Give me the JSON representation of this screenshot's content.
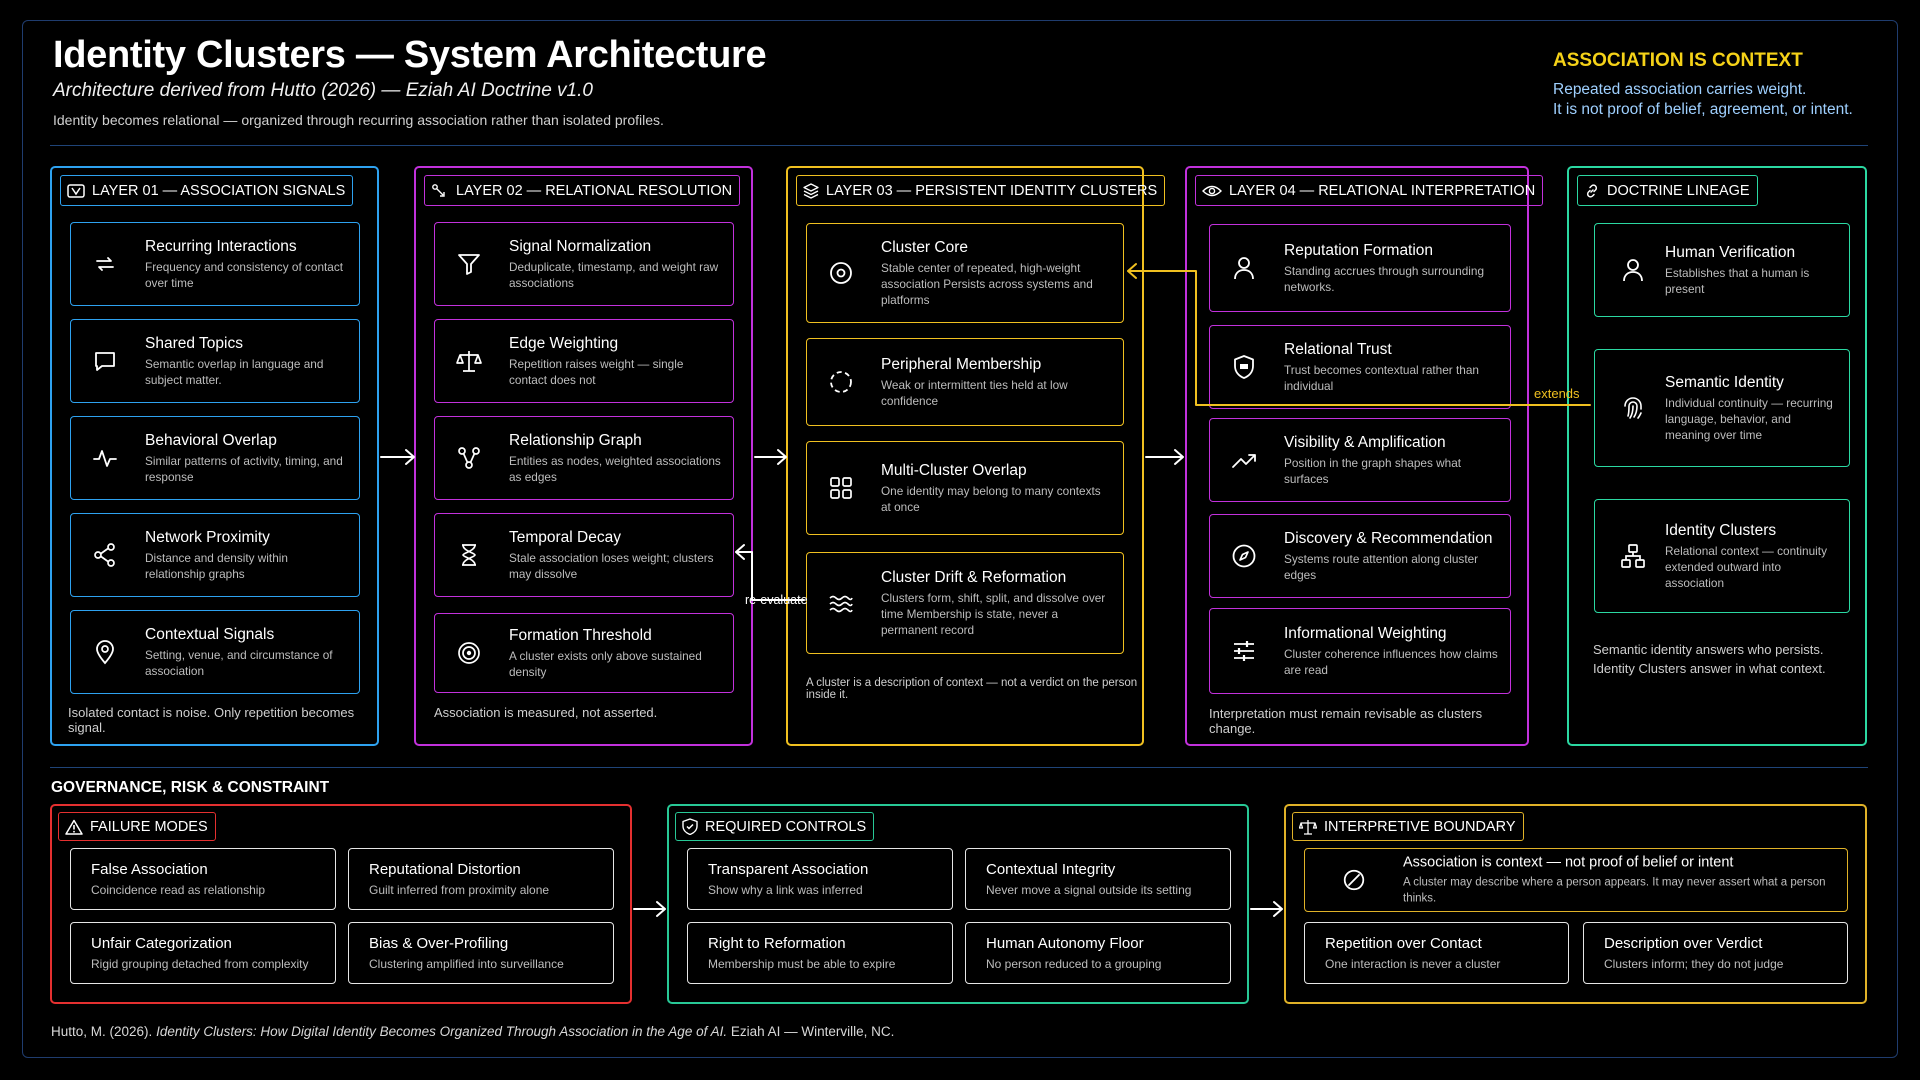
{
  "header": {
    "title": "Identity Clusters — System Architecture",
    "subtitle": "Architecture derived from Hutto (2026) — Eziah AI Doctrine v1.0",
    "tagline": "Identity becomes relational — organized through recurring association rather than isolated profiles.",
    "context_heading": "ASSOCIATION IS CONTEXT",
    "context_line1": "Repeated association carries weight.",
    "context_line2": "It is not proof of belief, agreement, or intent."
  },
  "layers": [
    {
      "title": "LAYER 01 — ASSOCIATION SIGNALS",
      "color": "#2ea2f0",
      "footer": "Isolated contact is noise. Only repetition becomes signal.",
      "cards": [
        {
          "name": "Recurring Interactions",
          "desc": "Frequency and consistency of contact over time",
          "icon": "repeat-icon"
        },
        {
          "name": "Shared Topics",
          "desc": "Semantic overlap in language and subject matter.",
          "icon": "chat-bubble-icon"
        },
        {
          "name": "Behavioral Overlap",
          "desc": "Similar patterns of activity, timing, and response",
          "icon": "pulse-icon"
        },
        {
          "name": "Network Proximity",
          "desc": "Distance and density within relationship graphs",
          "icon": "share-nodes-icon"
        },
        {
          "name": "Contextual Signals",
          "desc": "Setting, venue, and circumstance of association",
          "icon": "location-pin-icon"
        }
      ]
    },
    {
      "title": "LAYER 02 — RELATIONAL RESOLUTION",
      "color": "#c231dc",
      "footer": "Association is measured, not asserted.",
      "cards": [
        {
          "name": "Signal Normalization",
          "desc": "Deduplicate, timestamp, and weight raw associations",
          "icon": "filter-icon"
        },
        {
          "name": "Edge Weighting",
          "desc": "Repetition raises weight — single contact does not",
          "icon": "scale-icon"
        },
        {
          "name": "Relationship Graph",
          "desc": "Entities as nodes, weighted associations as edges",
          "icon": "graph-icon"
        },
        {
          "name": "Temporal Decay",
          "desc": "Stale association loses weight; clusters may dissolve",
          "icon": "hourglass-icon"
        },
        {
          "name": "Formation Threshold",
          "desc": "A cluster exists only above sustained density",
          "icon": "target-icon"
        }
      ]
    },
    {
      "title": "LAYER 03 — PERSISTENT IDENTITY CLUSTERS",
      "color": "#f0c020",
      "footer": "A cluster is a description of context — not a verdict on the person inside it.",
      "cards": [
        {
          "name": "Cluster Core",
          "desc": "Stable center of repeated, high-weight association Persists across systems and platforms",
          "icon": "core-icon"
        },
        {
          "name": "Peripheral Membership",
          "desc": "Weak or intermittent ties held at low confidence",
          "icon": "dashed-circle-icon"
        },
        {
          "name": "Multi-Cluster Overlap",
          "desc": "One identity may belong to many contexts at once",
          "icon": "grid-icon"
        },
        {
          "name": "Cluster Drift & Reformation",
          "desc": "Clusters form, shift, split, and dissolve over time Membership is state, never a permanent record",
          "icon": "waves-icon"
        }
      ]
    },
    {
      "title": "LAYER 04 — RELATIONAL INTERPRETATION",
      "color": "#c231dc",
      "footer": "Interpretation must remain revisable as clusters change.",
      "cards": [
        {
          "name": "Reputation Formation",
          "desc": "Standing accrues through surrounding networks.",
          "icon": "user-icon"
        },
        {
          "name": "Relational Trust",
          "desc": "Trust becomes contextual rather than individual",
          "icon": "shield-icon"
        },
        {
          "name": "Visibility & Amplification",
          "desc": "Position in the graph shapes what surfaces",
          "icon": "trending-up-icon"
        },
        {
          "name": "Discovery & Recommendation",
          "desc": "Systems route attention along cluster edges",
          "icon": "compass-icon"
        },
        {
          "name": "Informational Weighting",
          "desc": "Cluster coherence influences how claims are read",
          "icon": "sliders-icon"
        }
      ]
    },
    {
      "title": "DOCTRINE LINEAGE",
      "color": "#2bd8a2",
      "footer_line1": "Semantic identity answers who persists.",
      "footer_line2": "Identity Clusters answer in what context.",
      "cards": [
        {
          "name": "Human Verification",
          "desc": "Establishes that a human is present",
          "icon": "user-icon"
        },
        {
          "name": "Semantic Identity",
          "desc": "Individual continuity — recurring language, behavior, and meaning over time",
          "icon": "fingerprint-icon"
        },
        {
          "name": "Identity Clusters",
          "desc": "Relational context — continuity extended outward into association",
          "icon": "hierarchy-icon"
        }
      ]
    }
  ],
  "connectors": {
    "extends_label": "extends",
    "reevaluate_label": "re-evaluate"
  },
  "governance": {
    "heading": "GOVERNANCE, RISK & CONSTRAINT",
    "failure_modes": {
      "title": "FAILURE MODES",
      "color": "#e53030",
      "items": [
        {
          "name": "False Association",
          "desc": "Coincidence read as relationship"
        },
        {
          "name": "Reputational Distortion",
          "desc": "Guilt inferred from proximity alone"
        },
        {
          "name": "Unfair Categorization",
          "desc": "Rigid grouping detached from complexity"
        },
        {
          "name": "Bias & Over-Profiling",
          "desc": "Clustering amplified into surveillance"
        }
      ]
    },
    "required_controls": {
      "title": "REQUIRED CONTROLS",
      "color": "#28c896",
      "items": [
        {
          "name": "Transparent Association",
          "desc": "Show why a link was inferred"
        },
        {
          "name": "Contextual Integrity",
          "desc": "Never move a signal outside its setting"
        },
        {
          "name": "Right to Reformation",
          "desc": "Membership must be able to expire"
        },
        {
          "name": "Human Autonomy Floor",
          "desc": "No person reduced to a grouping"
        }
      ]
    },
    "interpretive_boundary": {
      "title": "INTERPRETIVE BOUNDARY",
      "color": "#e0b228",
      "main": {
        "name": "Association is context — not proof of belief or intent",
        "desc": "A cluster may describe where a person appears. It may never assert what a person thinks."
      },
      "items": [
        {
          "name": "Repetition over Contact",
          "desc": "One interaction is never a cluster"
        },
        {
          "name": "Description over Verdict",
          "desc": "Clusters inform; they do not judge"
        }
      ]
    }
  },
  "citation": {
    "author": "Hutto, M. (2026).",
    "work": "Identity Clusters: How Digital Identity Becomes Organized Through Association in the Age of AI.",
    "publisher": "Eziah AI — Winterville, NC."
  }
}
